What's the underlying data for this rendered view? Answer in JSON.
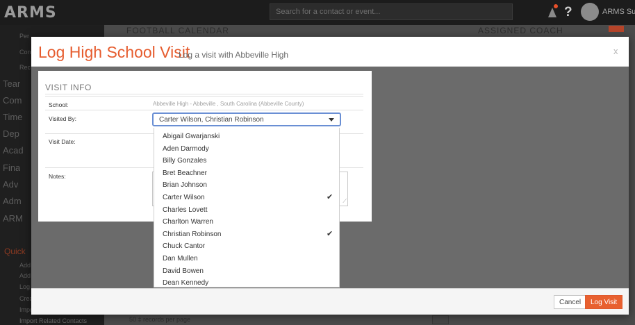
{
  "app": {
    "logo": "ARMS",
    "search_placeholder": "Search for a contact or event...",
    "user_name": "ARMS Supp",
    "help": "?"
  },
  "sidebar": {
    "small_top": [
      "Per",
      "Con",
      "Rec"
    ],
    "big": [
      "Tear",
      "Com",
      "Time",
      "Dep",
      "Acad",
      "Fina",
      "Adv",
      "Adm",
      "ARM"
    ],
    "quick": "Quick",
    "small_bottom": [
      "Add",
      "Add",
      "Log",
      "Crea",
      "Impo"
    ],
    "last": "Import Related Contacts"
  },
  "background": {
    "heading": "FOOTBALL CALENDAR",
    "heading2": "ASSIGNED COACH",
    "records": "50 ‡ records per page"
  },
  "modal": {
    "title": "Log High School Visit",
    "subtitle": "Log a visit with Abbeville High",
    "close": "x",
    "section_title": "VISIT INFO",
    "school_label": "School:",
    "school_value": "Abbeville High - Abbeville , South Carolina (Abbeville County)",
    "visited_by_label": "Visited By:",
    "visited_by_value": "Carter Wilson, Christian Robinson",
    "visit_date_label": "Visit Date:",
    "notes_label": "Notes:",
    "cancel_label": "Cancel",
    "log_visit_label": "Log Visit"
  },
  "dropdown": {
    "items": [
      {
        "name": "Abigail Gwarjanski",
        "checked": false
      },
      {
        "name": "Aden Darmody",
        "checked": false
      },
      {
        "name": "Billy Gonzales",
        "checked": false
      },
      {
        "name": "Bret Beachner",
        "checked": false
      },
      {
        "name": "Brian Johnson",
        "checked": false
      },
      {
        "name": "Carter Wilson",
        "checked": true
      },
      {
        "name": "Charles Lovett",
        "checked": false
      },
      {
        "name": "Charlton Warren",
        "checked": false
      },
      {
        "name": "Christian Robinson",
        "checked": true
      },
      {
        "name": "Chuck Cantor",
        "checked": false
      },
      {
        "name": "Dan Mullen",
        "checked": false
      },
      {
        "name": "David Bowen",
        "checked": false
      },
      {
        "name": "Dean Kennedy",
        "checked": false
      }
    ],
    "check_glyph": "✔"
  }
}
